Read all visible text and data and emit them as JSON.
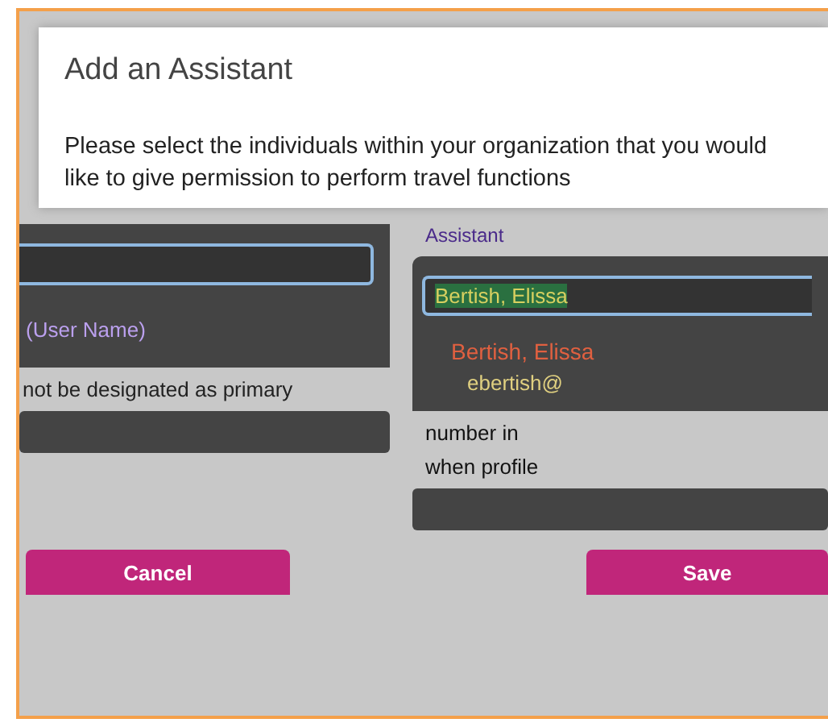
{
  "dialog": {
    "title": "Add an Assistant",
    "instructions": "Please select the individuals within your organization that you would like to give permission to perform travel functions"
  },
  "left_panel": {
    "list_items": [
      "(User Name)"
    ],
    "note": "not be designated as primary"
  },
  "right_panel": {
    "label": "Assistant",
    "field_value": "Bertish, Elissa",
    "selected_name": "Bertish, Elissa",
    "email": "ebertish@",
    "note_lines": [
      "number in",
      "when profile"
    ]
  },
  "buttons": [
    {
      "label": "Cancel",
      "kind": "cancel"
    },
    {
      "label": "Save",
      "kind": "save"
    }
  ]
}
